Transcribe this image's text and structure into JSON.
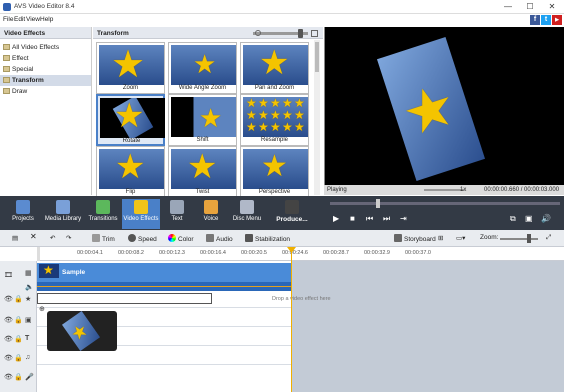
{
  "window": {
    "title": "AVS Video Editor 8.4",
    "min": "—",
    "max": "☐",
    "close": "✕"
  },
  "menu": [
    "File",
    "Edit",
    "View",
    "Help"
  ],
  "social": {
    "fb": "f",
    "tw": "t",
    "yt": "▶"
  },
  "left_panel": {
    "title": "Video Effects",
    "items": [
      {
        "label": "All Video Effects",
        "selected": false
      },
      {
        "label": "Effect",
        "selected": false
      },
      {
        "label": "Special",
        "selected": false
      },
      {
        "label": "Transform",
        "selected": true
      },
      {
        "label": "Draw",
        "selected": false
      }
    ]
  },
  "effects_panel": {
    "title": "Transform",
    "effects": [
      {
        "label": "Zoom",
        "selected": false
      },
      {
        "label": "Wide Angle Zoom",
        "selected": false
      },
      {
        "label": "Pan and Zoom",
        "selected": false
      },
      {
        "label": "Rotate",
        "selected": true
      },
      {
        "label": "Shift",
        "selected": false
      },
      {
        "label": "Resample",
        "selected": false
      },
      {
        "label": "Flip",
        "selected": false
      },
      {
        "label": "Twist",
        "selected": false
      },
      {
        "label": "Perspective",
        "selected": false
      }
    ]
  },
  "preview": {
    "status": "Playing",
    "speed": "1x",
    "time": "00:00:00.660 / 00:00:03.000"
  },
  "toolbar": {
    "tools": [
      {
        "label": "Projects",
        "color": "#5b8bd0",
        "selected": false
      },
      {
        "label": "Media Library",
        "color": "#7aa0d8",
        "selected": false
      },
      {
        "label": "Transitions",
        "color": "#5cb85c",
        "selected": false
      },
      {
        "label": "Video Effects",
        "color": "#f0c419",
        "selected": true
      },
      {
        "label": "Text",
        "color": "#9aa6b8",
        "selected": false
      },
      {
        "label": "Voice",
        "color": "#e8a33d",
        "selected": false
      },
      {
        "label": "Disc Menu",
        "color": "#b0b8c8",
        "selected": false
      },
      {
        "label": "Produce...",
        "color": "#444",
        "selected": false
      }
    ]
  },
  "edit_tools": {
    "trim": "Trim",
    "speed": "Speed",
    "color": "Color",
    "audio": "Audio",
    "stabilization": "Stabilization",
    "storyboard": "Storyboard",
    "zoom": "Zoom:"
  },
  "timeline": {
    "ticks": [
      "00:00:04.1",
      "00:00:08.2",
      "00:00:12.3",
      "00:00:16.4",
      "00:00:20.5",
      "00:00:24.6",
      "00:00:28.7",
      "00:00:32.9",
      "00:00:37.0"
    ],
    "clip_label": "Sample",
    "drop_hint": "Drop a video effect here"
  }
}
